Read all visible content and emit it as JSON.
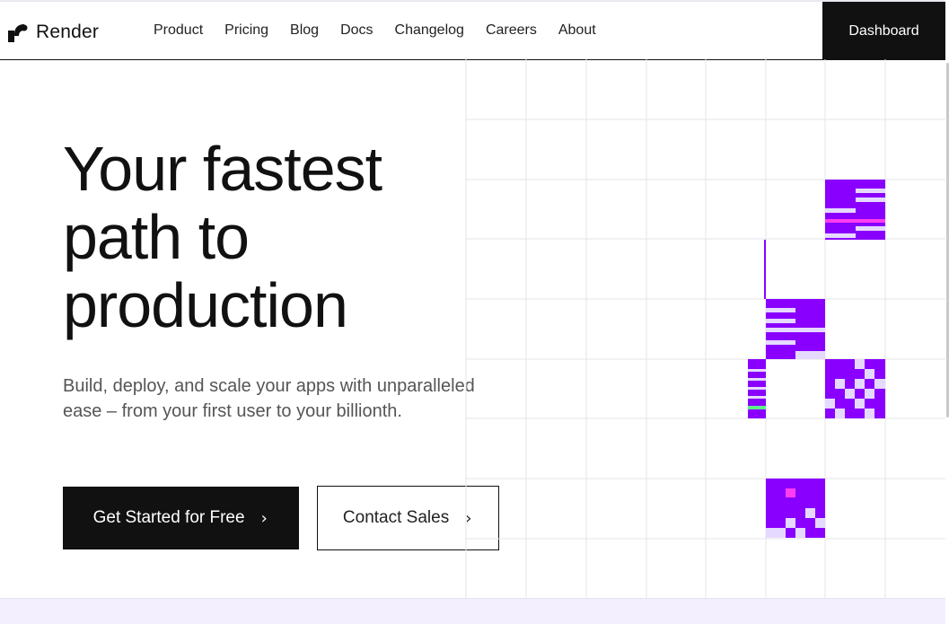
{
  "brand": {
    "name": "Render"
  },
  "nav": {
    "links": [
      "Product",
      "Pricing",
      "Blog",
      "Docs",
      "Changelog",
      "Careers",
      "About"
    ],
    "dashboard_label": "Dashboard"
  },
  "hero": {
    "title_lines": [
      "Your fastest",
      "path to",
      "production"
    ],
    "subtitle_lines": [
      "Build, deploy, and scale your apps with unparalleled",
      "ease – from your first user to your billionth."
    ],
    "primary_cta": "Get Started for Free",
    "secondary_cta": "Contact Sales"
  },
  "colors": {
    "accent_purple": "#8a00ff",
    "accent_light": "#e6d9ff",
    "accent_pink": "#ff3df0",
    "accent_green": "#5cf08a",
    "dark": "#111111"
  },
  "icons": {
    "cta_arrow": "chevron-right-icon",
    "logo": "render-logo-icon"
  }
}
